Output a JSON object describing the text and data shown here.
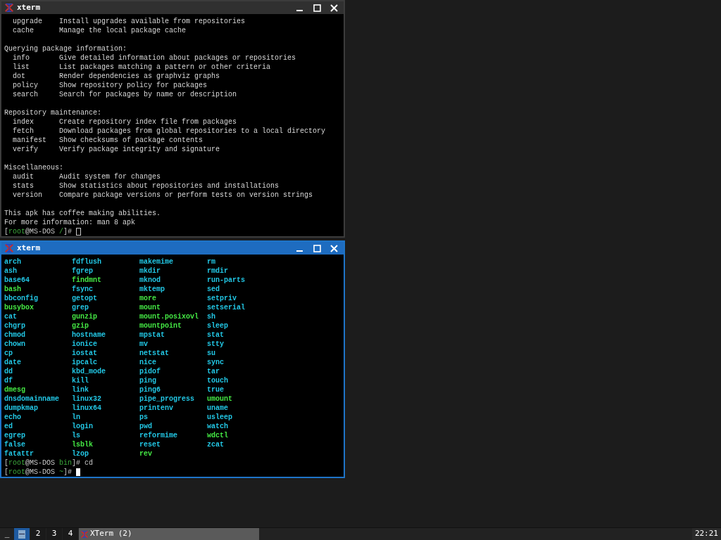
{
  "windows": [
    {
      "title": "xterm",
      "active": false,
      "kind": "text",
      "lines": [
        {
          "kind": "command",
          "name": "upgrade",
          "description": "Install upgrades available from repositories"
        },
        {
          "kind": "command",
          "name": "cache",
          "description": "Manage the local package cache"
        },
        {
          "kind": "blank"
        },
        {
          "kind": "heading",
          "text": "Querying package information:"
        },
        {
          "kind": "command",
          "name": "info",
          "description": "Give detailed information about packages or repositories"
        },
        {
          "kind": "command",
          "name": "list",
          "description": "List packages matching a pattern or other criteria"
        },
        {
          "kind": "command",
          "name": "dot",
          "description": "Render dependencies as graphviz graphs"
        },
        {
          "kind": "command",
          "name": "policy",
          "description": "Show repository policy for packages"
        },
        {
          "kind": "command",
          "name": "search",
          "description": "Search for packages by name or description"
        },
        {
          "kind": "blank"
        },
        {
          "kind": "heading",
          "text": "Repository maintenance:"
        },
        {
          "kind": "command",
          "name": "index",
          "description": "Create repository index file from packages"
        },
        {
          "kind": "command",
          "name": "fetch",
          "description": "Download packages from global repositories to a local directory"
        },
        {
          "kind": "command",
          "name": "manifest",
          "description": "Show checksums of package contents"
        },
        {
          "kind": "command",
          "name": "verify",
          "description": "Verify package integrity and signature"
        },
        {
          "kind": "blank"
        },
        {
          "kind": "heading",
          "text": "Miscellaneous:"
        },
        {
          "kind": "command",
          "name": "audit",
          "description": "Audit system for changes"
        },
        {
          "kind": "command",
          "name": "stats",
          "description": "Show statistics about repositories and installations"
        },
        {
          "kind": "command",
          "name": "version",
          "description": "Compare package versions or perform tests on version strings"
        },
        {
          "kind": "blank"
        },
        {
          "kind": "heading",
          "text": "This apk has coffee making abilities."
        },
        {
          "kind": "heading",
          "text": "For more information: man 8 apk"
        },
        {
          "kind": "prompt",
          "cursor": true,
          "segments": [
            {
              "text": "[",
              "kind": "plain"
            },
            {
              "text": "root",
              "kind": "user"
            },
            {
              "text": "@MS-DOS ",
              "kind": "plain"
            },
            {
              "text": "/",
              "kind": "dir"
            },
            {
              "text": "]# ",
              "kind": "plain"
            }
          ]
        }
      ]
    },
    {
      "title": "xterm",
      "active": true,
      "kind": "listing",
      "columns": [
        [
          {
            "name": "arch",
            "color": "#22c8e6"
          },
          {
            "name": "ash",
            "color": "#22c8e6"
          },
          {
            "name": "base64",
            "color": "#22c8e6"
          },
          {
            "name": "bash",
            "color": "#44e844"
          },
          {
            "name": "bbconfig",
            "color": "#22c8e6"
          },
          {
            "name": "busybox",
            "color": "#44e844"
          },
          {
            "name": "cat",
            "color": "#22c8e6"
          },
          {
            "name": "chgrp",
            "color": "#22c8e6"
          },
          {
            "name": "chmod",
            "color": "#22c8e6"
          },
          {
            "name": "chown",
            "color": "#22c8e6"
          },
          {
            "name": "cp",
            "color": "#22c8e6"
          },
          {
            "name": "date",
            "color": "#22c8e6"
          },
          {
            "name": "dd",
            "color": "#22c8e6"
          },
          {
            "name": "df",
            "color": "#22c8e6"
          },
          {
            "name": "dmesg",
            "color": "#44e844"
          },
          {
            "name": "dnsdomainname",
            "color": "#22c8e6"
          },
          {
            "name": "dumpkmap",
            "color": "#22c8e6"
          },
          {
            "name": "echo",
            "color": "#22c8e6"
          },
          {
            "name": "ed",
            "color": "#22c8e6"
          },
          {
            "name": "egrep",
            "color": "#22c8e6"
          },
          {
            "name": "false",
            "color": "#22c8e6"
          },
          {
            "name": "fatattr",
            "color": "#22c8e6"
          }
        ],
        [
          {
            "name": "fdflush",
            "color": "#22c8e6"
          },
          {
            "name": "fgrep",
            "color": "#22c8e6"
          },
          {
            "name": "findmnt",
            "color": "#44e844"
          },
          {
            "name": "fsync",
            "color": "#22c8e6"
          },
          {
            "name": "getopt",
            "color": "#22c8e6"
          },
          {
            "name": "grep",
            "color": "#22c8e6"
          },
          {
            "name": "gunzip",
            "color": "#44e844"
          },
          {
            "name": "gzip",
            "color": "#44e844"
          },
          {
            "name": "hostname",
            "color": "#22c8e6"
          },
          {
            "name": "ionice",
            "color": "#22c8e6"
          },
          {
            "name": "iostat",
            "color": "#22c8e6"
          },
          {
            "name": "ipcalc",
            "color": "#22c8e6"
          },
          {
            "name": "kbd_mode",
            "color": "#22c8e6"
          },
          {
            "name": "kill",
            "color": "#22c8e6"
          },
          {
            "name": "link",
            "color": "#22c8e6"
          },
          {
            "name": "linux32",
            "color": "#22c8e6"
          },
          {
            "name": "linux64",
            "color": "#22c8e6"
          },
          {
            "name": "ln",
            "color": "#22c8e6"
          },
          {
            "name": "login",
            "color": "#22c8e6"
          },
          {
            "name": "ls",
            "color": "#22c8e6"
          },
          {
            "name": "lsblk",
            "color": "#44e844"
          },
          {
            "name": "lzop",
            "color": "#22c8e6"
          }
        ],
        [
          {
            "name": "makemime",
            "color": "#22c8e6"
          },
          {
            "name": "mkdir",
            "color": "#22c8e6"
          },
          {
            "name": "mknod",
            "color": "#22c8e6"
          },
          {
            "name": "mktemp",
            "color": "#22c8e6"
          },
          {
            "name": "more",
            "color": "#44e844"
          },
          {
            "name": "mount",
            "color": "#44e844"
          },
          {
            "name": "mount.posixovl",
            "color": "#44e844"
          },
          {
            "name": "mountpoint",
            "color": "#44e844"
          },
          {
            "name": "mpstat",
            "color": "#22c8e6"
          },
          {
            "name": "mv",
            "color": "#22c8e6"
          },
          {
            "name": "netstat",
            "color": "#22c8e6"
          },
          {
            "name": "nice",
            "color": "#22c8e6"
          },
          {
            "name": "pidof",
            "color": "#22c8e6"
          },
          {
            "name": "ping",
            "color": "#22c8e6"
          },
          {
            "name": "ping6",
            "color": "#22c8e6"
          },
          {
            "name": "pipe_progress",
            "color": "#22c8e6"
          },
          {
            "name": "printenv",
            "color": "#22c8e6"
          },
          {
            "name": "ps",
            "color": "#22c8e6"
          },
          {
            "name": "pwd",
            "color": "#22c8e6"
          },
          {
            "name": "reformime",
            "color": "#22c8e6"
          },
          {
            "name": "reset",
            "color": "#22c8e6"
          },
          {
            "name": "rev",
            "color": "#44e844"
          }
        ],
        [
          {
            "name": "rm",
            "color": "#22c8e6"
          },
          {
            "name": "rmdir",
            "color": "#22c8e6"
          },
          {
            "name": "run-parts",
            "color": "#22c8e6"
          },
          {
            "name": "sed",
            "color": "#22c8e6"
          },
          {
            "name": "setpriv",
            "color": "#22c8e6"
          },
          {
            "name": "setserial",
            "color": "#22c8e6"
          },
          {
            "name": "sh",
            "color": "#22c8e6"
          },
          {
            "name": "sleep",
            "color": "#22c8e6"
          },
          {
            "name": "stat",
            "color": "#22c8e6"
          },
          {
            "name": "stty",
            "color": "#22c8e6"
          },
          {
            "name": "su",
            "color": "#22c8e6"
          },
          {
            "name": "sync",
            "color": "#22c8e6"
          },
          {
            "name": "tar",
            "color": "#22c8e6"
          },
          {
            "name": "touch",
            "color": "#22c8e6"
          },
          {
            "name": "true",
            "color": "#22c8e6"
          },
          {
            "name": "umount",
            "color": "#44e844"
          },
          {
            "name": "uname",
            "color": "#22c8e6"
          },
          {
            "name": "usleep",
            "color": "#22c8e6"
          },
          {
            "name": "watch",
            "color": "#22c8e6"
          },
          {
            "name": "wdctl",
            "color": "#44e844"
          },
          {
            "name": "zcat",
            "color": "#22c8e6"
          }
        ]
      ],
      "lines": [
        {
          "kind": "prompt",
          "cursor": false,
          "segments": [
            {
              "text": "[",
              "kind": "plain"
            },
            {
              "text": "root",
              "kind": "user"
            },
            {
              "text": "@MS-DOS ",
              "kind": "plain"
            },
            {
              "text": "bin",
              "kind": "dir"
            },
            {
              "text": "]# cd",
              "kind": "plain"
            }
          ]
        },
        {
          "kind": "prompt",
          "cursor": true,
          "segments": [
            {
              "text": "[",
              "kind": "plain"
            },
            {
              "text": "root",
              "kind": "user"
            },
            {
              "text": "@MS-DOS ",
              "kind": "plain"
            },
            {
              "text": "~",
              "kind": "dir"
            },
            {
              "text": "]# ",
              "kind": "plain"
            }
          ]
        }
      ]
    }
  ],
  "taskbar": {
    "show_desktop": "_",
    "workspaces": [
      {
        "kind": "icon",
        "selected": true
      },
      {
        "kind": "number",
        "label": "2",
        "selected": false
      },
      {
        "kind": "number",
        "label": "3",
        "selected": false
      },
      {
        "kind": "number",
        "label": "4",
        "selected": false
      }
    ],
    "tasks": [
      {
        "label": "XTerm (2)",
        "selected": true
      }
    ],
    "clock": "22:21"
  }
}
